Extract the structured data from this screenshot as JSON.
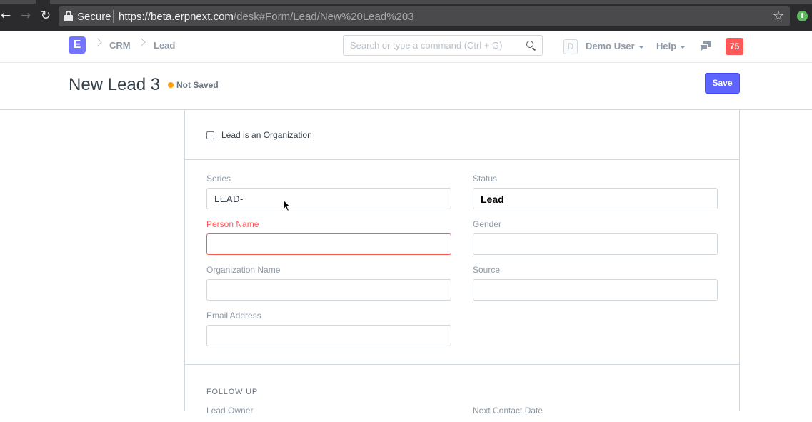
{
  "browser": {
    "secure_label": "Secure",
    "url_host": "https://beta.erpnext.com",
    "url_path": "/desk#Form/Lead/New%20Lead%203"
  },
  "navbar": {
    "logo_letter": "E",
    "breadcrumbs": [
      "CRM",
      "Lead"
    ],
    "search_placeholder": "Search or type a command (Ctrl + G)",
    "avatar_letter": "D",
    "user_menu": "Demo User",
    "help_menu": "Help",
    "notification_count": "75"
  },
  "page": {
    "title": "New Lead 3",
    "indicator": "Not Saved",
    "indicator_color": "#ffa00a",
    "save_label": "Save"
  },
  "form": {
    "org_checkbox_label": "Lead is an Organization",
    "org_checkbox_checked": false,
    "fields": {
      "series": {
        "label": "Series",
        "value": "LEAD-"
      },
      "status": {
        "label": "Status",
        "value": "Lead"
      },
      "person_name": {
        "label": "Person Name",
        "value": ""
      },
      "gender": {
        "label": "Gender",
        "value": ""
      },
      "organization_name": {
        "label": "Organization Name",
        "value": ""
      },
      "source": {
        "label": "Source",
        "value": ""
      },
      "email_address": {
        "label": "Email Address",
        "value": ""
      },
      "lead_owner": {
        "label": "Lead Owner"
      },
      "next_contact_date": {
        "label": "Next Contact Date"
      }
    },
    "follow_up_heading": "FOLLOW UP"
  }
}
